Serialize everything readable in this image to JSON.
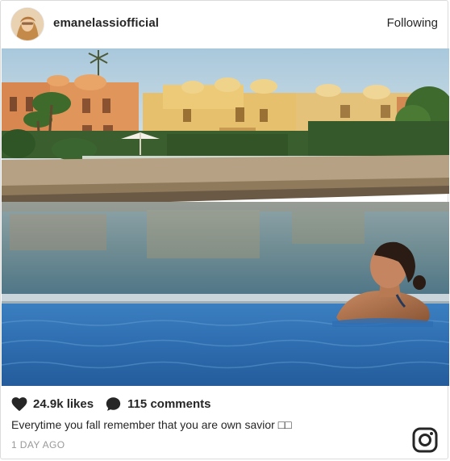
{
  "post": {
    "username": "emanelassiofficial",
    "follow_status": "Following",
    "likes": "24.9k likes",
    "comments": "115 comments",
    "caption": "Everytime you fall remember that you are own savior □□",
    "timestamp": "1 DAY AGO"
  },
  "icons": {
    "avatar": "profile-photo",
    "likes": "heart-icon",
    "comments": "comment-bubble-icon",
    "brand": "instagram-logo-icon"
  },
  "colors": {
    "text": "#262626",
    "muted": "#999999",
    "border": "#dbdbdb"
  }
}
